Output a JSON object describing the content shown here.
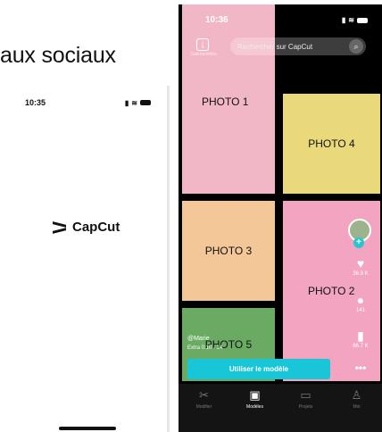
{
  "heading": "aux sociaux",
  "left_phone": {
    "time": "10:35",
    "brand": "CapCut"
  },
  "right_phone": {
    "time": "10:36",
    "search": {
      "placeholder": "Rechercher sur CapCut",
      "grid_label": "Galerie/vidéo"
    },
    "blocks": [
      "PHOTO 1",
      "PHOTO 4",
      "PHOTO 3",
      "PHOTO 2",
      "PHOTO 5"
    ],
    "rail": {
      "likes": "36.9 K",
      "comments": "141",
      "saves": "66.7 K"
    },
    "creator": "@Marie",
    "meta": "Extra 0:10 · 14",
    "cta": "Utiliser le modèle",
    "tabs": [
      "Modifier",
      "Modèles",
      "Projets",
      "Moi"
    ],
    "accent_color": "#19c6d7"
  }
}
